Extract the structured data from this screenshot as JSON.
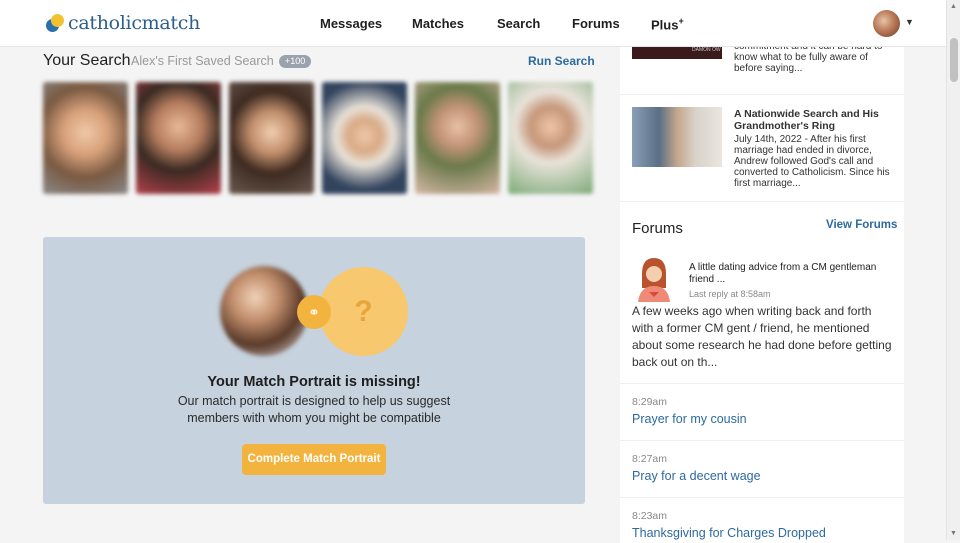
{
  "header": {
    "logo_text": "catholicmatch",
    "nav": [
      "Messages",
      "Matches",
      "Search",
      "Forums",
      "Plus"
    ],
    "plus_mark": "+"
  },
  "search": {
    "title": "Your Search",
    "subtitle": "Alex's First Saved Search",
    "badge": "+100",
    "run_label": "Run Search"
  },
  "portrait": {
    "title": "Your Match Portrait is missing!",
    "description": "Our match portrait is designed to help us suggest members with whom you might be compatible",
    "question_mark": "?",
    "button": "Complete Match Portrait"
  },
  "sidebar": {
    "article1": {
      "image_label": "DAMON OW",
      "text": "commitment and it can be hard to know what to be fully aware of before saying..."
    },
    "article2": {
      "title": "A Nationwide Search and His Grandmother's Ring",
      "text": "July 14th, 2022 - After his first marriage had ended in divorce, Andrew followed God's call and converted to Catholicism. Since his first marriage..."
    },
    "forums": {
      "title": "Forums",
      "view_label": "View Forums",
      "featured": {
        "title": "A little dating advice from a CM gentleman friend ...",
        "meta": "Last reply at 8:58am",
        "body": "A few weeks ago when writing back and forth with a former CM gent / friend, he mentioned about some research he had done before getting back out on th..."
      },
      "threads": [
        {
          "time": "8:29am",
          "title": "Prayer for my cousin"
        },
        {
          "time": "8:27am",
          "title": "Pray for a decent wage"
        },
        {
          "time": "8:23am",
          "title": "Thanksgiving for Charges Dropped"
        }
      ]
    }
  }
}
